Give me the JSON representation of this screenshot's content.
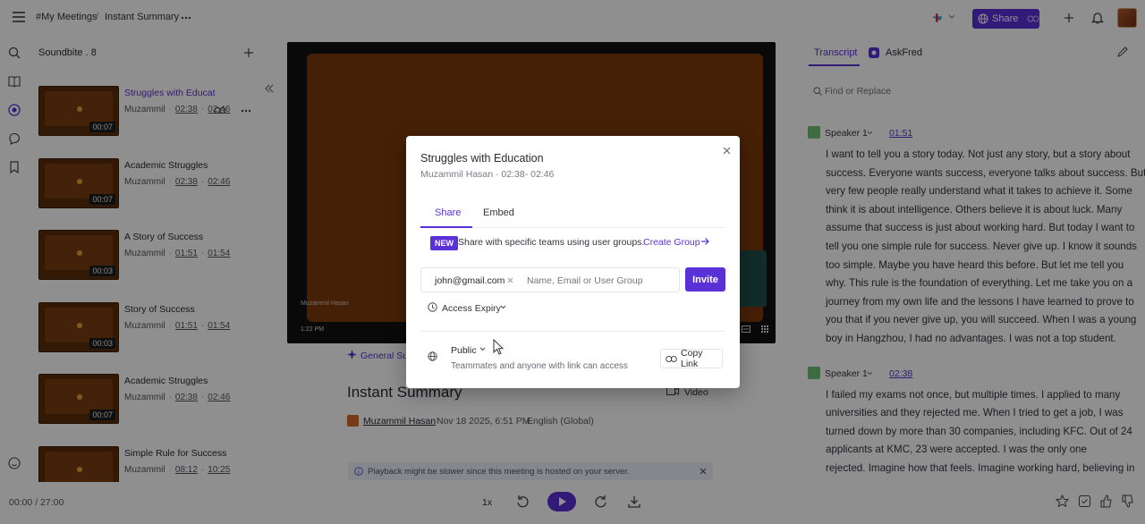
{
  "breadcrumb": {
    "workspace": "#My Meetings",
    "separator": "/",
    "page": "Instant Summary"
  },
  "topbar": {
    "share_label": "Share"
  },
  "sidebar": {
    "header": "Soundbite . 8",
    "items": [
      {
        "title": "Struggles with Educat",
        "author": "Muzammil",
        "start": "02:38",
        "end": "02:46",
        "duration": "00:07",
        "active": true
      },
      {
        "title": "Academic Struggles",
        "author": "Muzammil",
        "start": "02:38",
        "end": "02:46",
        "duration": "00:07"
      },
      {
        "title": "A Story of Success",
        "author": "Muzammil",
        "start": "01:51",
        "end": "01:54",
        "duration": "00:03"
      },
      {
        "title": "Story of Success",
        "author": "Muzammil",
        "start": "01:51",
        "end": "01:54",
        "duration": "00:03"
      },
      {
        "title": "Academic Struggles",
        "author": "Muzammil",
        "start": "02:38",
        "end": "02:46",
        "duration": "00:07"
      },
      {
        "title": "Simple Rule for Success",
        "author": "Muzammil",
        "start": "08:12",
        "end": "10:25",
        "duration": ""
      }
    ]
  },
  "video": {
    "caption_name": "Muzammil Hasan",
    "time": "1:22 PM"
  },
  "summary": {
    "tab_label": "General Su",
    "title": "Instant Summary",
    "host": "Muzammil Hasan",
    "date": "Nov 18 2025, 6:51 PM",
    "language": "English (Global)",
    "video_label": "Video",
    "notice": "Playback might be slower since this meeting is hosted on your server."
  },
  "right_panel": {
    "tabs": [
      "Transcript",
      "AskFred"
    ],
    "search_placeholder": "Find or Replace",
    "blocks": [
      {
        "speaker": "Speaker 1",
        "time": "01:51",
        "lines": [
          "I want to tell you a story today. Not just any story, but a story about",
          "success. Everyone wants success, everyone talks about success. But",
          "very few people really understand what it takes to achieve it. Some",
          "think it is about intelligence. Others believe it is about luck. Many",
          "assume that success is just about working hard. But today I want to",
          "tell you one simple rule for success. Never give up. I know it sounds",
          "too simple. Maybe you have heard this before. But let me tell you",
          "why. This rule is the foundation of everything. Let me take you on a",
          "journey from my own life and the lessons I have learned to prove to",
          "you that if you never give up, you will succeed. When I was a young",
          "boy in Hangzhou, I had no advantages. I was not a top student."
        ]
      },
      {
        "speaker": "Speaker 1",
        "time": "02:38",
        "lines": [
          "I failed my exams not once, but multiple times. I applied to many",
          "universities and they rejected me. When I tried to get a job, I was",
          "turned down by more than 30 companies, including KFC. Out of 24",
          "applicants at KMC, 23 were accepted. I was the only one",
          "rejected. Imagine how that feels. Imagine working hard, believing in"
        ]
      }
    ]
  },
  "player": {
    "time": "00:00 / 27:00",
    "speed": "1x"
  },
  "modal": {
    "title": "Struggles with Education",
    "subtitle": "Muzammil Hasan · 02:38- 02:46",
    "tabs": [
      "Share",
      "Embed"
    ],
    "new_badge": "NEW",
    "promo_text": "Share with specific teams using user groups.",
    "promo_link": "Create Group",
    "email_chip": "john@gmail.com",
    "input_placeholder": "Name, Email or User Group",
    "invite_label": "Invite",
    "access_expiry": "Access Expiry",
    "visibility": "Public",
    "visibility_desc": "Teammates and anyone with link can access",
    "copy_link": "Copy Link"
  },
  "colors": {
    "accent": "#5a31d6",
    "overlay": "rgba(0,0,0,0.44)"
  }
}
